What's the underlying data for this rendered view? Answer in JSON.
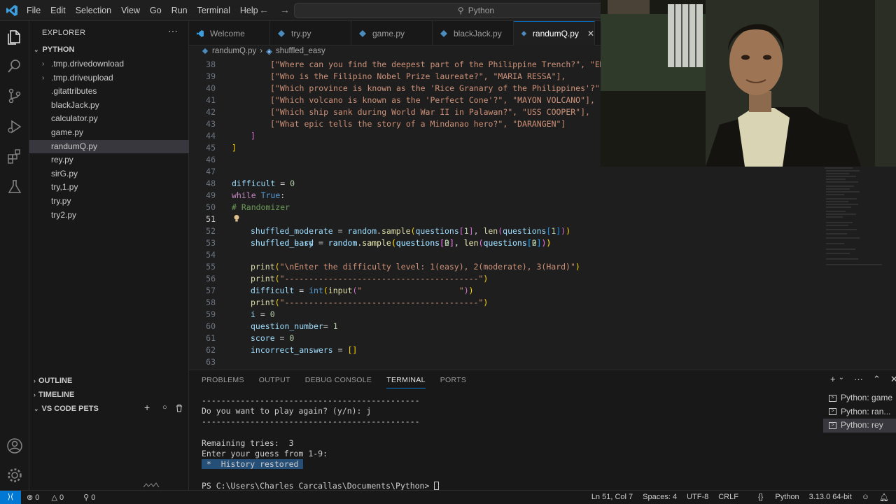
{
  "titlebar": {
    "menu": [
      "File",
      "Edit",
      "Selection",
      "View",
      "Go",
      "Run",
      "Terminal",
      "Help"
    ],
    "search_text": "Python"
  },
  "sidebar": {
    "title": "EXPLORER",
    "root": "PYTHON",
    "items": [
      {
        "label": ".tmp.drivedownload",
        "folder": true
      },
      {
        "label": ".tmp.driveupload",
        "folder": true
      },
      {
        "label": ".gitattributes"
      },
      {
        "label": "blackJack.py"
      },
      {
        "label": "calculator.py"
      },
      {
        "label": "game.py"
      },
      {
        "label": "randumQ.py",
        "active": true
      },
      {
        "label": "rey.py"
      },
      {
        "label": "sirG.py"
      },
      {
        "label": "try,1.py"
      },
      {
        "label": "try.py"
      },
      {
        "label": "try2.py"
      }
    ],
    "sections": [
      "OUTLINE",
      "TIMELINE",
      "VS CODE PETS"
    ]
  },
  "tabs": [
    {
      "label": "Welcome"
    },
    {
      "label": "try.py"
    },
    {
      "label": "game.py"
    },
    {
      "label": "blackJack.py"
    },
    {
      "label": "randumQ.py",
      "active": true
    }
  ],
  "breadcrumb": {
    "file": "randumQ.py",
    "symbol": "shuffled_easy"
  },
  "editor": {
    "current_line": 51,
    "lines": {
      "l38": "[\"Where can you find the deepest part of the Philippine Trench?\", \"EM",
      "l39": "[\"Who is the Filipino Nobel Prize laureate?\", \"MARIA RESSA\"],",
      "l40": "[\"Which province is known as the 'Rice Granary of the Philippines'?\",",
      "l41": "[\"Which volcano is known as the 'Perfect Cone'?\", \"MAYON VOLCANO\"],",
      "l42": "[\"Which ship sank during World War II in Palawan?\", \"USS COOPER\"],",
      "l43": "[\"What epic tells the story of a Mindanao hero?\", \"DARANGEN\"]",
      "l50": "# Randomizer",
      "l55_str": "\"\\nEnter the difficulty level: 1(easy), 2(moderate), 3(Hard)\"",
      "l56_str": "\"----------------------------------------\"",
      "l57_str": "\"                    \"",
      "l58_str": "\"----------------------------------------\""
    }
  },
  "panel": {
    "tabs": [
      "PROBLEMS",
      "OUTPUT",
      "DEBUG CONSOLE",
      "TERMINAL",
      "PORTS"
    ],
    "active_tab": "TERMINAL",
    "terminal_lines": [
      "---------------------------------------------",
      "Do you want to play again? (y/n): j",
      "---------------------------------------------",
      "",
      "Remaining tries:  3",
      "Enter your guess from 1-9:"
    ],
    "history_restored": " *  History restored ",
    "prompt": "PS C:\\Users\\Charles Carcallas\\Documents\\Python> ",
    "terminals": [
      "Python: game",
      "Python: ran...",
      "Python: rey"
    ]
  },
  "statusbar": {
    "errors": "0",
    "warnings": "0",
    "ports": "0",
    "position": "Ln 51, Col 7",
    "spaces": "Spaces: 4",
    "encoding": "UTF-8",
    "eol": "CRLF",
    "language": "Python",
    "interpreter": "3.13.0 64-bit"
  },
  "colors": {
    "accent": "#0078d4",
    "background": "#1e1e1e",
    "string": "#ce9178",
    "keyword": "#c586c0",
    "variable": "#9cdcfe",
    "function": "#dcdcaa",
    "comment": "#6a9955"
  }
}
